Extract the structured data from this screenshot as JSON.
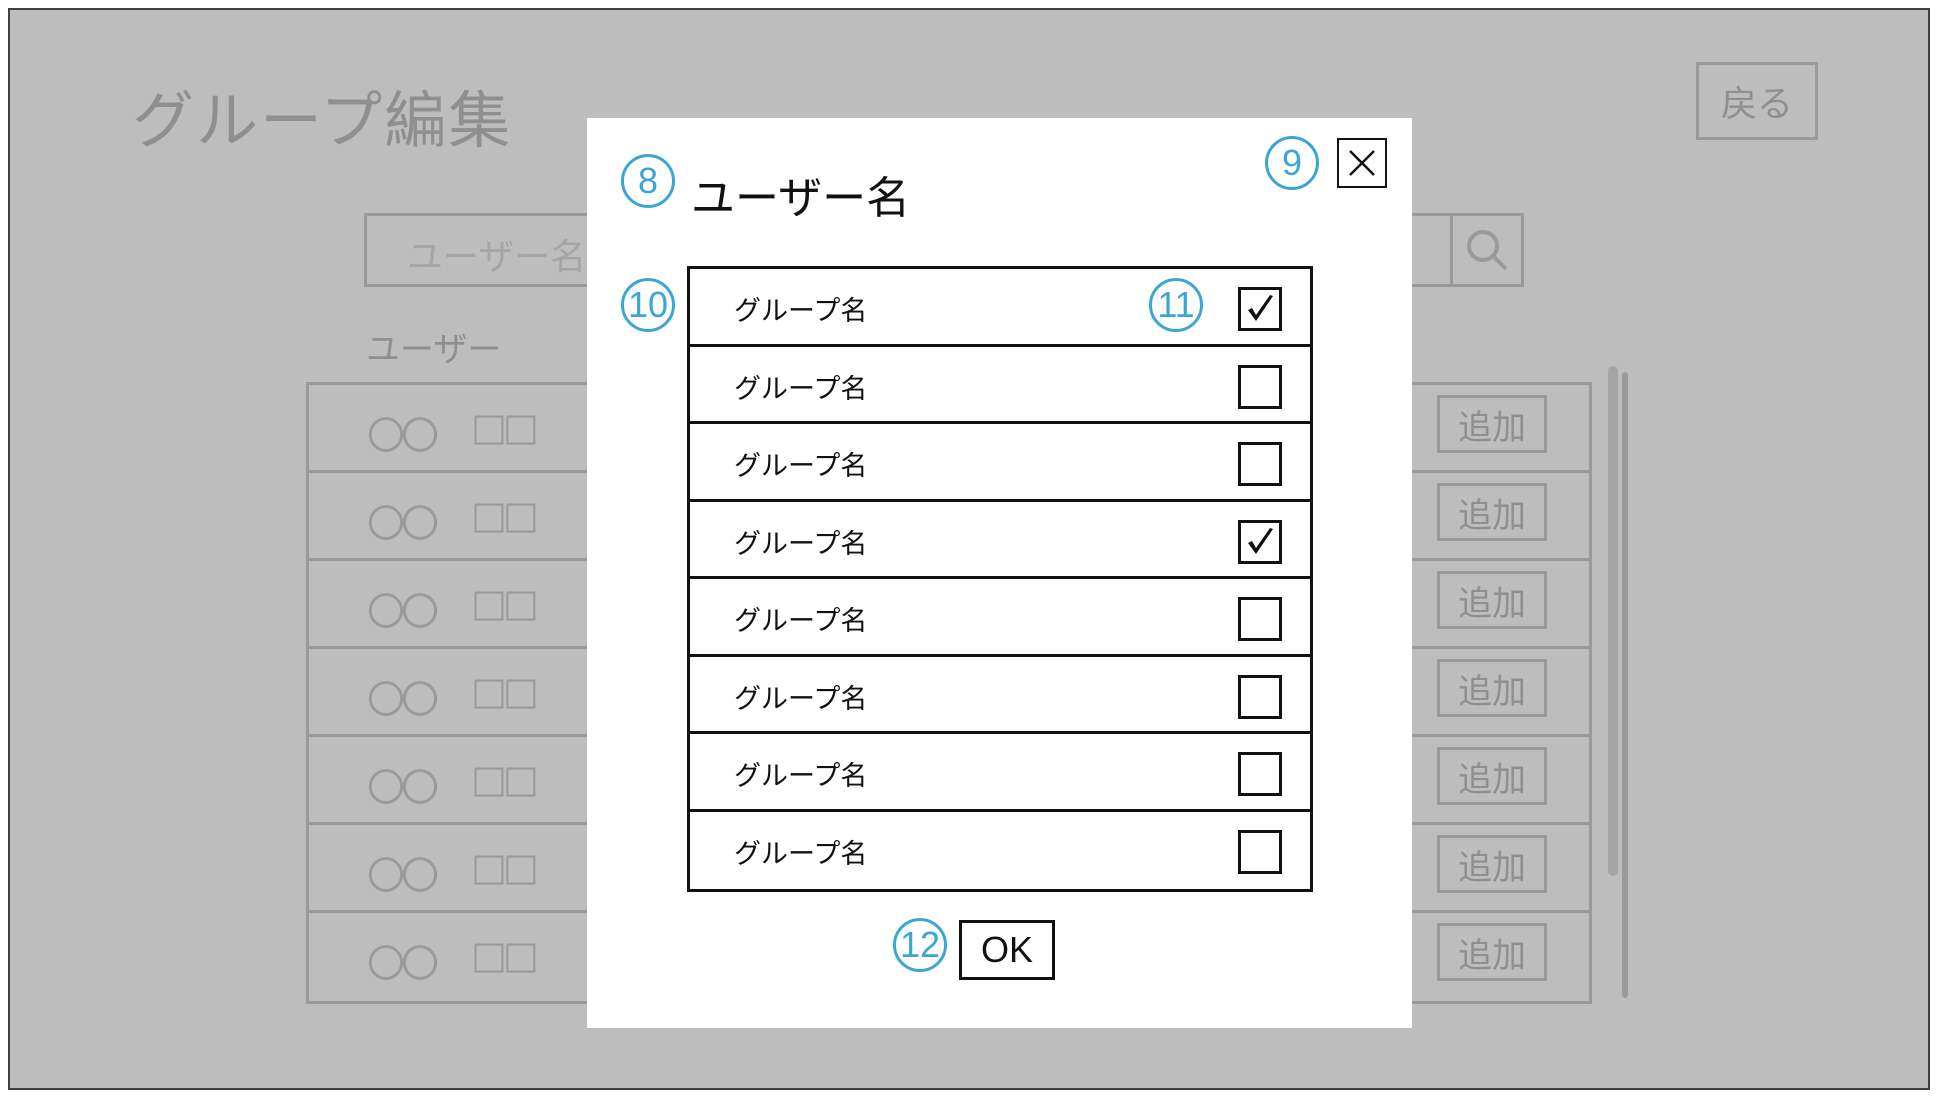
{
  "screen": {
    "title": "グループ編集",
    "back_label": "戻る",
    "search": {
      "placeholder": "ユーザー名"
    },
    "section_label": "ユーザー",
    "users": [
      {
        "first": "〇〇",
        "last": "□□",
        "action": "追加"
      },
      {
        "first": "〇〇",
        "last": "□□",
        "action": "追加"
      },
      {
        "first": "〇〇",
        "last": "□□",
        "action": "追加"
      },
      {
        "first": "〇〇",
        "last": "□□",
        "action": "追加"
      },
      {
        "first": "〇〇",
        "last": "□□",
        "action": "追加"
      },
      {
        "first": "〇〇",
        "last": "□□",
        "action": "追加"
      },
      {
        "first": "〇〇",
        "last": "□□",
        "action": "追加"
      }
    ]
  },
  "modal": {
    "title": "ユーザー名",
    "ok_label": "OK",
    "annotations": {
      "title": "8",
      "close": "9",
      "list": "10",
      "checkbox": "11",
      "ok": "12"
    },
    "groups": [
      {
        "name": "グループ名",
        "checked": true
      },
      {
        "name": "グループ名",
        "checked": false
      },
      {
        "name": "グループ名",
        "checked": false
      },
      {
        "name": "グループ名",
        "checked": true
      },
      {
        "name": "グループ名",
        "checked": false
      },
      {
        "name": "グループ名",
        "checked": false
      },
      {
        "name": "グループ名",
        "checked": false
      },
      {
        "name": "グループ名",
        "checked": false
      }
    ]
  },
  "colors": {
    "annotation": "#3aa6d3",
    "overlay": "#bdbdbd"
  },
  "icons": {
    "search": "search-icon",
    "close": "close-icon",
    "check": "check-icon"
  }
}
